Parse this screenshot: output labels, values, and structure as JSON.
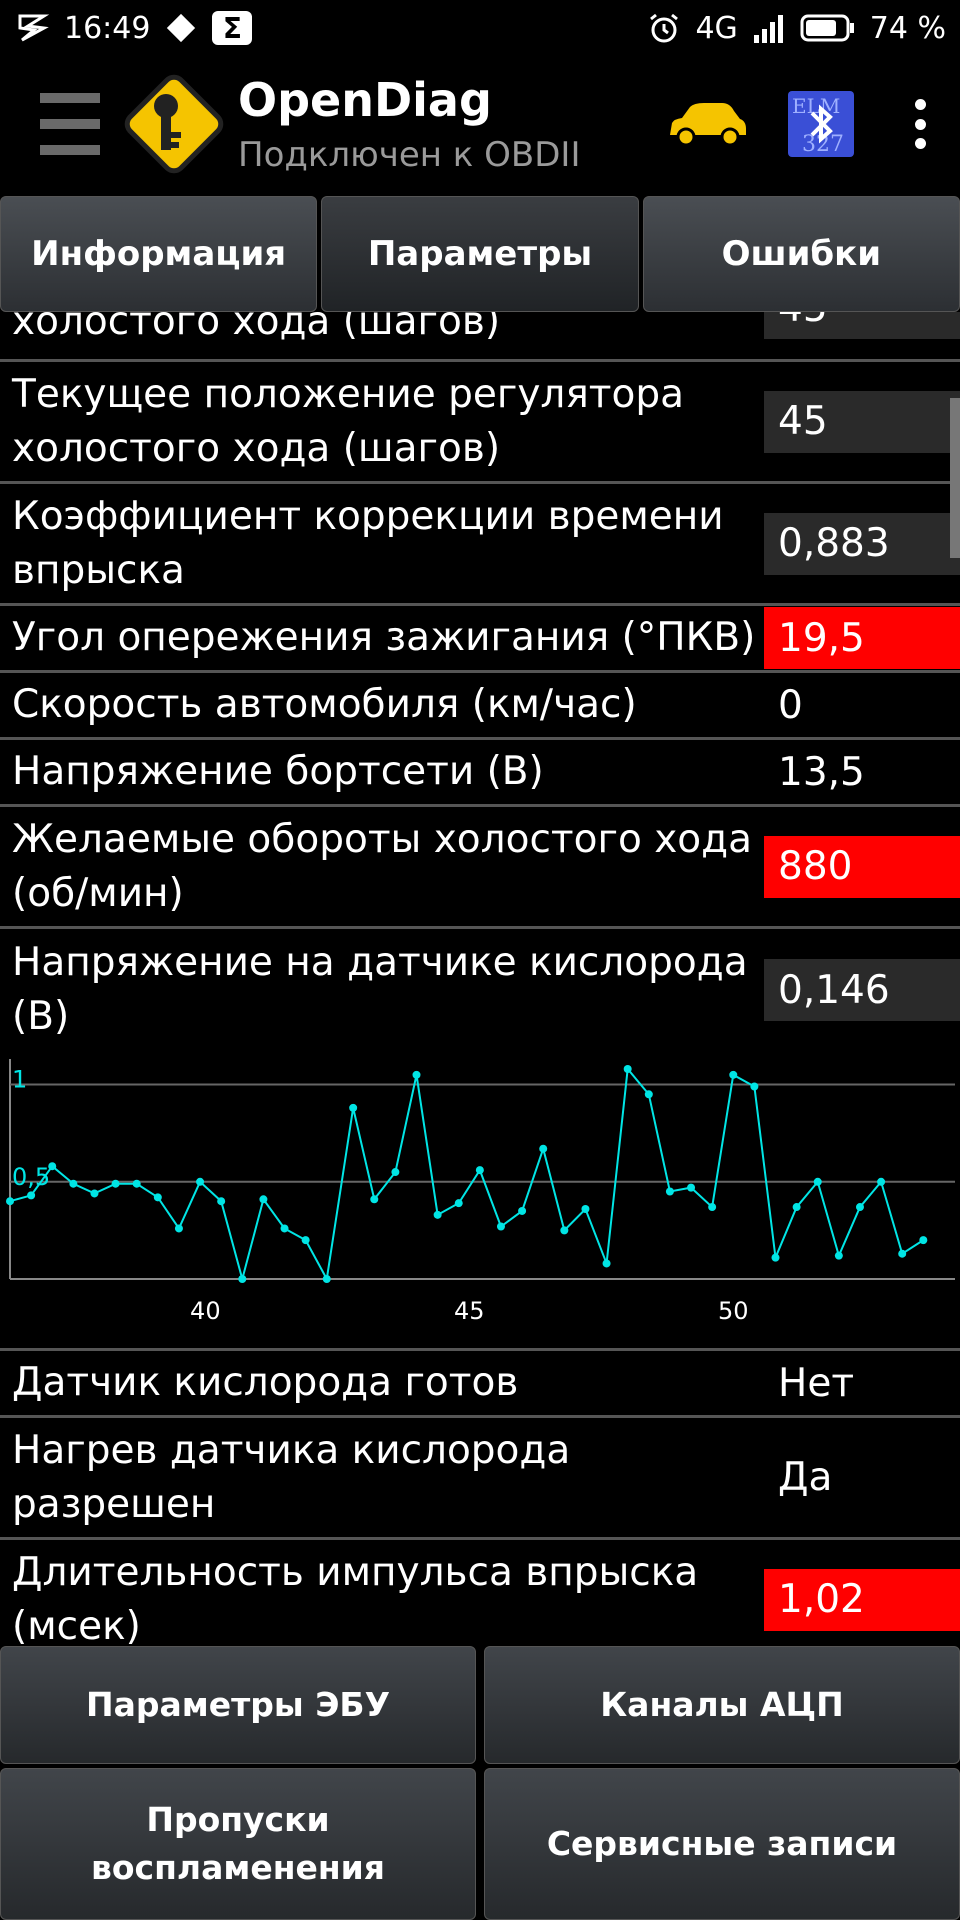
{
  "status_bar": {
    "time": "16:49",
    "network": "4G",
    "battery": "74 %"
  },
  "toolbar": {
    "title": "OpenDiag",
    "subtitle": "Подключен к OBDII",
    "bt_badge_text": "ELM 327"
  },
  "tabs": [
    {
      "label": "Информация",
      "active": false
    },
    {
      "label": "Параметры",
      "active": true
    },
    {
      "label": "Ошибки",
      "active": false
    }
  ],
  "parameters": [
    {
      "label": "Желаемое положение регулятора холостого хода (шагов)",
      "visible_label": "холостого хода (шагов)",
      "value": "45",
      "highlight": false
    },
    {
      "label": "Текущее положение регулятора\nхолостого хода (шагов)",
      "value": "45",
      "highlight": false
    },
    {
      "label": "Коэффициент коррекции времени\nвпрыска",
      "value": "0,883",
      "highlight": false
    },
    {
      "label": "Угол опережения зажигания (°ПКВ)",
      "value": "19,5",
      "highlight": true
    },
    {
      "label": "Скорость автомобиля (км/час)",
      "value": "0",
      "highlight": false
    },
    {
      "label": "Напряжение бортсети (В)",
      "value": "13,5",
      "highlight": false
    },
    {
      "label": "Желаемые обороты холостого хода\n(об/мин)",
      "value": "880",
      "highlight": true
    },
    {
      "label": "Напряжение на датчике кислорода\n(В)",
      "value": "0,146",
      "highlight": false
    },
    {
      "label": "Датчик кислорода готов",
      "value": "Нет",
      "highlight": false
    },
    {
      "label": "Нагрев датчика кислорода\nразрешен",
      "value": "Да",
      "highlight": false
    },
    {
      "label": "Длительность импульса впрыска\n(мсек)",
      "value": "1,02",
      "highlight": true
    }
  ],
  "chart_data": {
    "type": "line",
    "xlim": [
      36.3,
      54.2
    ],
    "ylim": [
      0,
      1.08
    ],
    "xticks": [
      40,
      45,
      50
    ],
    "yticks": [
      0.5,
      1
    ],
    "ytick_labels": [
      "0,5",
      "1"
    ],
    "grid": true,
    "color": "#00e5e5",
    "x": [
      36.3,
      36.7,
      37.1,
      37.5,
      37.9,
      38.3,
      38.7,
      39.1,
      39.5,
      39.9,
      40.3,
      40.7,
      41.1,
      41.5,
      41.9,
      42.3,
      42.8,
      43.2,
      43.6,
      44.0,
      44.4,
      44.8,
      45.2,
      45.6,
      46.0,
      46.4,
      46.8,
      47.2,
      47.6,
      48.0,
      48.4,
      48.8,
      49.2,
      49.6,
      50.0,
      50.4,
      50.8,
      51.2,
      51.6,
      52.0,
      52.4,
      52.8,
      53.2,
      53.6
    ],
    "y": [
      0.4,
      0.43,
      0.58,
      0.49,
      0.44,
      0.49,
      0.49,
      0.42,
      0.26,
      0.5,
      0.4,
      0.0,
      0.41,
      0.26,
      0.2,
      0.0,
      0.88,
      0.41,
      0.55,
      1.05,
      0.33,
      0.39,
      0.56,
      0.27,
      0.35,
      0.67,
      0.25,
      0.36,
      0.08,
      1.08,
      0.95,
      0.45,
      0.47,
      0.37,
      1.05,
      0.99,
      0.11,
      0.37,
      0.5,
      0.12,
      0.37,
      0.5,
      0.13,
      0.2
    ]
  },
  "bottom_buttons": [
    "Параметры ЭБУ",
    "Каналы АЦП",
    "Пропуски\nвоспламенения",
    "Сервисные записи"
  ]
}
